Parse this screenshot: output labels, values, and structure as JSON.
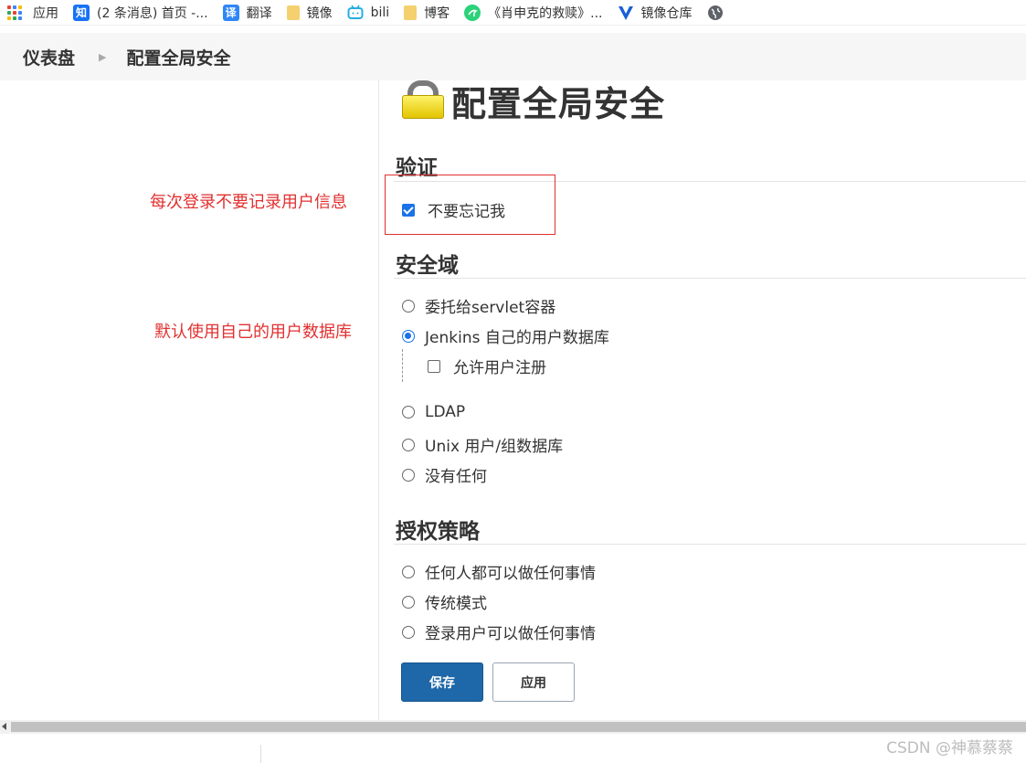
{
  "bookmarks": [
    {
      "label": "应用",
      "icon": "apps-grid-icon"
    },
    {
      "label": "(2 条消息) 首页 -...",
      "icon": "zhihu-icon",
      "icon_text": "知",
      "color": "#1772f6"
    },
    {
      "label": "翻译",
      "icon": "translate-icon",
      "icon_text": "译",
      "color": "#2f86f6"
    },
    {
      "label": "镜像",
      "icon": "folder-icon"
    },
    {
      "label": "bili",
      "icon": "bilibili-icon",
      "color": "#23ade5"
    },
    {
      "label": "博客",
      "icon": "folder-icon"
    },
    {
      "label": "《肖申克的救赎》...",
      "icon": "movie-site-icon",
      "color": "#2bd27a"
    },
    {
      "label": "镜像仓库",
      "icon": "v-logo-icon",
      "color": "#1a5fd6"
    },
    {
      "label": "",
      "icon": "globe-icon"
    }
  ],
  "breadcrumb": {
    "items": [
      "仪表盘",
      "配置全局安全"
    ]
  },
  "annotations": {
    "remember_me": "每次登录不要记录用户信息",
    "user_db": "默认使用自己的用户数据库"
  },
  "page": {
    "title": "配置全局安全"
  },
  "sections": {
    "auth": {
      "title": "验证",
      "disable_remember_me": {
        "label": "不要忘记我",
        "checked": true
      }
    },
    "realm": {
      "title": "安全域",
      "options": [
        {
          "label": "委托给servlet容器",
          "selected": false
        },
        {
          "label": "Jenkins 自己的用户数据库",
          "selected": true
        },
        {
          "label": "LDAP",
          "selected": false
        },
        {
          "label": "Unix 用户/组数据库",
          "selected": false
        },
        {
          "label": "没有任何",
          "selected": false
        }
      ],
      "allow_signup": {
        "label": "允许用户注册",
        "checked": false
      }
    },
    "authorization": {
      "title": "授权策略",
      "options": [
        {
          "label": "任何人都可以做任何事情",
          "selected": false
        },
        {
          "label": "传统模式",
          "selected": false
        },
        {
          "label": "登录用户可以做任何事情",
          "selected": false
        }
      ]
    }
  },
  "buttons": {
    "save": "保存",
    "apply": "应用"
  },
  "watermark": "CSDN @神慕蔡蔡",
  "colors": {
    "accent": "#1a73e8",
    "primary_button": "#1e67a8",
    "annotation": "#e23030"
  }
}
